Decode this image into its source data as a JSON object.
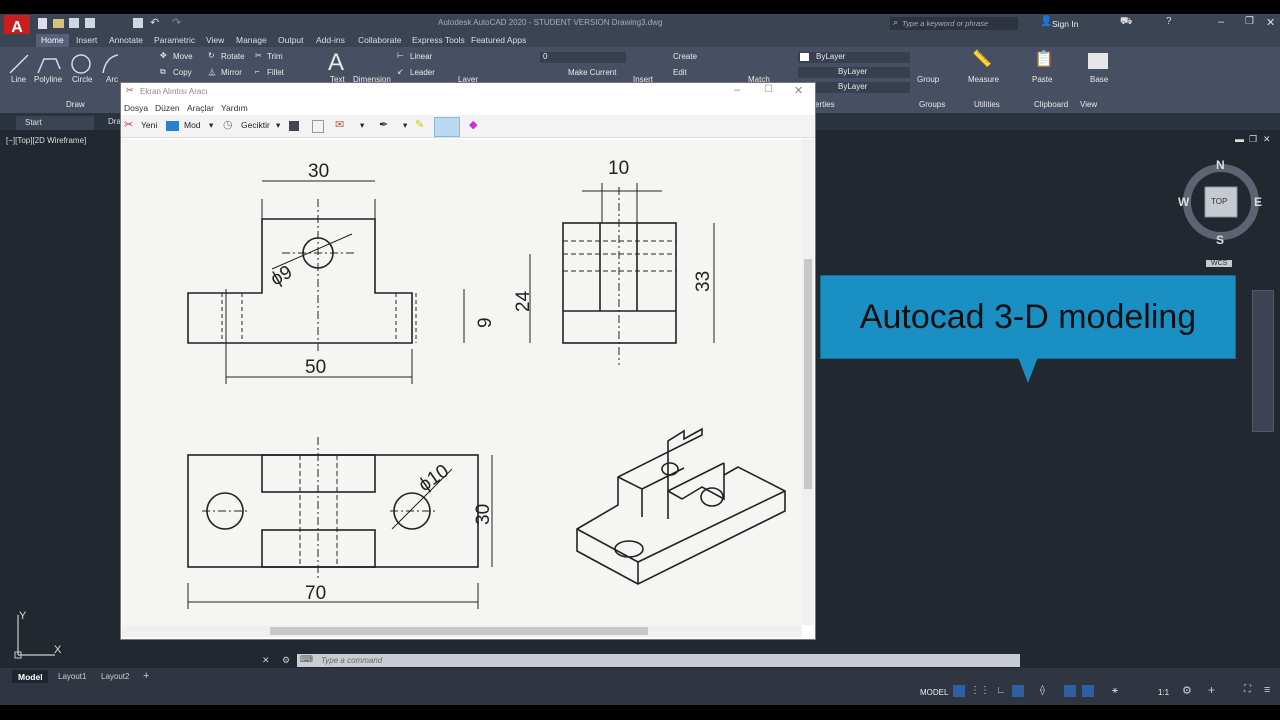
{
  "app": {
    "logo": "A",
    "title": "Autodesk AutoCAD 2020 - STUDENT VERSION    Drawing3.dwg",
    "search_placeholder": "Type a keyword or phrase",
    "sign_in": "Sign In"
  },
  "ribbon_tabs": [
    "Home",
    "Insert",
    "Annotate",
    "Parametric",
    "View",
    "Manage",
    "Output",
    "Add-ins",
    "Collaborate",
    "Express Tools",
    "Featured Apps"
  ],
  "ribbon": {
    "draw": {
      "line": "Line",
      "polyline": "Polyline",
      "circle": "Circle",
      "arc": "Arc",
      "group_label": "Draw"
    },
    "modify": {
      "move": "Move",
      "rotate": "Rotate",
      "trim": "Trim",
      "copy": "Copy",
      "mirror": "Mirror",
      "fillet": "Fillet"
    },
    "annotation": {
      "text": "Text",
      "dimension": "Dimension",
      "linear": "Linear",
      "leader": "Leader"
    },
    "layers": {
      "layer_value": "0",
      "make_current": "Make Current",
      "layer_label": "Layer"
    },
    "block": {
      "create": "Create",
      "edit": "Edit",
      "insert": "Insert"
    },
    "properties": {
      "match": "Match",
      "bylayer1": "ByLayer",
      "bylayer2": "ByLayer",
      "bylayer3": "ByLayer",
      "label": "erties"
    },
    "groups": {
      "group": "Group",
      "label": "Groups"
    },
    "utilities": {
      "measure": "Measure",
      "label": "Utilities"
    },
    "clipboard": {
      "paste": "Paste",
      "label": "Clipboard"
    },
    "view": {
      "base": "Base",
      "label": "View"
    }
  },
  "doc_tabs": {
    "start": "Start",
    "drawing": "Dra"
  },
  "viewport_label": "[−][Top][2D Wireframe]",
  "snip": {
    "title": "Ekran Alıntısı Aracı",
    "menu": [
      "Dosya",
      "Düzen",
      "Araçlar",
      "Yardım"
    ],
    "new": "Yeni",
    "mode": "Mod",
    "delay": "Geciktir"
  },
  "drawing": {
    "dim_30_top": "30",
    "dim_phi9": "ϕ9",
    "dim_9": "9",
    "dim_50": "50",
    "dim_10": "10",
    "dim_24": "24",
    "dim_33": "33",
    "dim_phi10": "ϕ10",
    "dim_30_side": "30",
    "dim_70": "70"
  },
  "banner": {
    "text": "Autocad 3-D modeling"
  },
  "viewcube": {
    "n": "N",
    "s": "S",
    "e": "E",
    "w": "W",
    "top": "TOP",
    "wcs": "WCS"
  },
  "ucs": {
    "y": "Y",
    "x": "X"
  },
  "command": {
    "placeholder": "Type a command"
  },
  "layout_tabs": [
    "Model",
    "Layout1",
    "Layout2"
  ],
  "status": {
    "model": "MODEL",
    "scale": "1:1"
  }
}
